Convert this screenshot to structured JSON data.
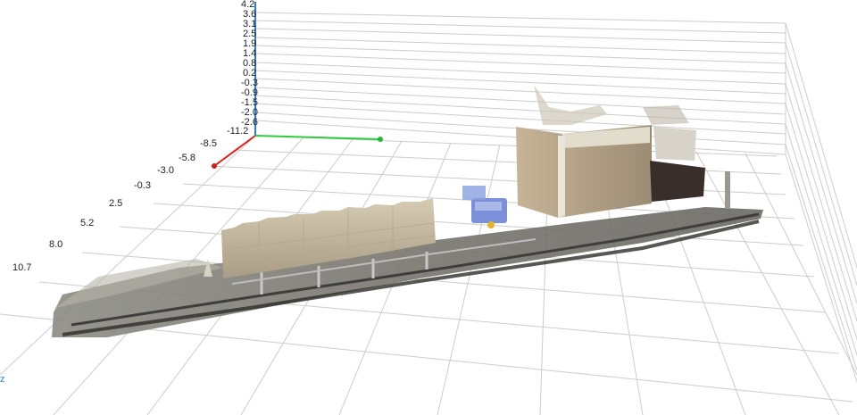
{
  "viewer": {
    "y_ticks": [
      "4.2",
      "3.6",
      "3.1",
      "2.5",
      "1.9",
      "1.4",
      "0.8",
      "0.2",
      "-0.3",
      "-0.9",
      "-1.5",
      "-2.0",
      "-2.6"
    ],
    "z_ticks": [
      "-11.2",
      "-8.5",
      "-5.8",
      "-3.0",
      "-0.3",
      "2.5",
      "5.2",
      "8.0",
      "10.7"
    ],
    "axis_label": "z",
    "colors": {
      "x_axis": "#e02020",
      "y_axis": "#2a7fd4",
      "z_axis": "#2ecc40",
      "grid": "#cccccc",
      "background": "#ffffff"
    }
  }
}
